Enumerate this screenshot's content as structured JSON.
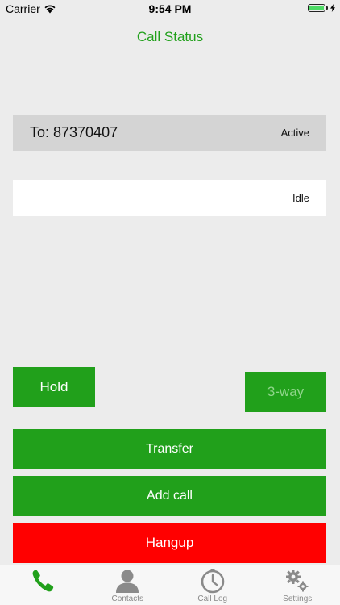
{
  "status_bar": {
    "carrier": "Carrier",
    "time": "9:54 PM",
    "battery_level": 1.0
  },
  "nav": {
    "title": "Call Status"
  },
  "calls": [
    {
      "number": "To: 87370407",
      "state": "Active"
    },
    {
      "number": "",
      "state": "Idle"
    }
  ],
  "buttons": {
    "hold": "Hold",
    "three_way": "3-way",
    "transfer": "Transfer",
    "add_call": "Add call",
    "hangup": "Hangup"
  },
  "tabs": [
    {
      "label": "",
      "icon": "phone-icon",
      "selected": true
    },
    {
      "label": "Contacts",
      "icon": "person-icon",
      "selected": false
    },
    {
      "label": "Call Log",
      "icon": "clock-icon",
      "selected": false
    },
    {
      "label": "Settings",
      "icon": "gears-icon",
      "selected": false
    }
  ],
  "colors": {
    "accent": "#21a01b",
    "hangup": "#ff0000",
    "background": "#ececec",
    "tab_icon_inactive": "#8a8a8a"
  }
}
